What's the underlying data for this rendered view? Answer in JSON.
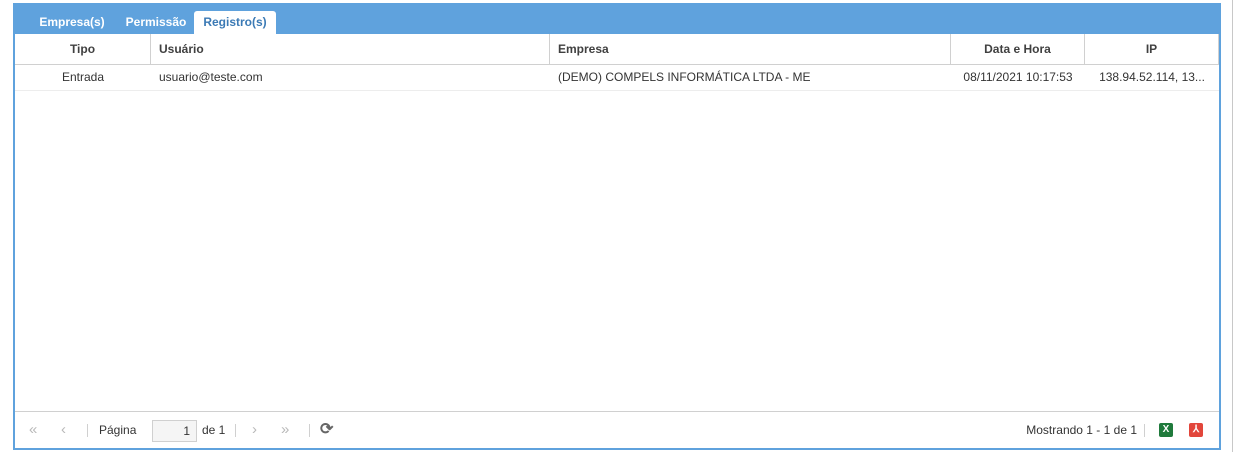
{
  "tabs": [
    {
      "label": "Empresa(s)"
    },
    {
      "label": "Permissão"
    },
    {
      "label": "Registro(s)"
    }
  ],
  "columns": [
    "Tipo",
    "Usuário",
    "Empresa",
    "Data e Hora",
    "IP"
  ],
  "rows": [
    {
      "tipo": "Entrada",
      "usuario": "usuario@teste.com",
      "empresa": "(DEMO) COMPELS INFORMÁTICA LTDA - ME",
      "data_hora": "08/11/2021 10:17:53",
      "ip": "138.94.52.114, 13..."
    }
  ],
  "paging": {
    "page_label": "Página",
    "current_page": "1",
    "of_label": "de 1",
    "status": "Mostrando 1 - 1 de 1"
  },
  "icons": {
    "excel_glyph": "X",
    "pdf_glyph": "⅄"
  },
  "colors": {
    "accent": "#5fa2dd",
    "excel": "#1f7a3c",
    "pdf": "#e2463b"
  }
}
